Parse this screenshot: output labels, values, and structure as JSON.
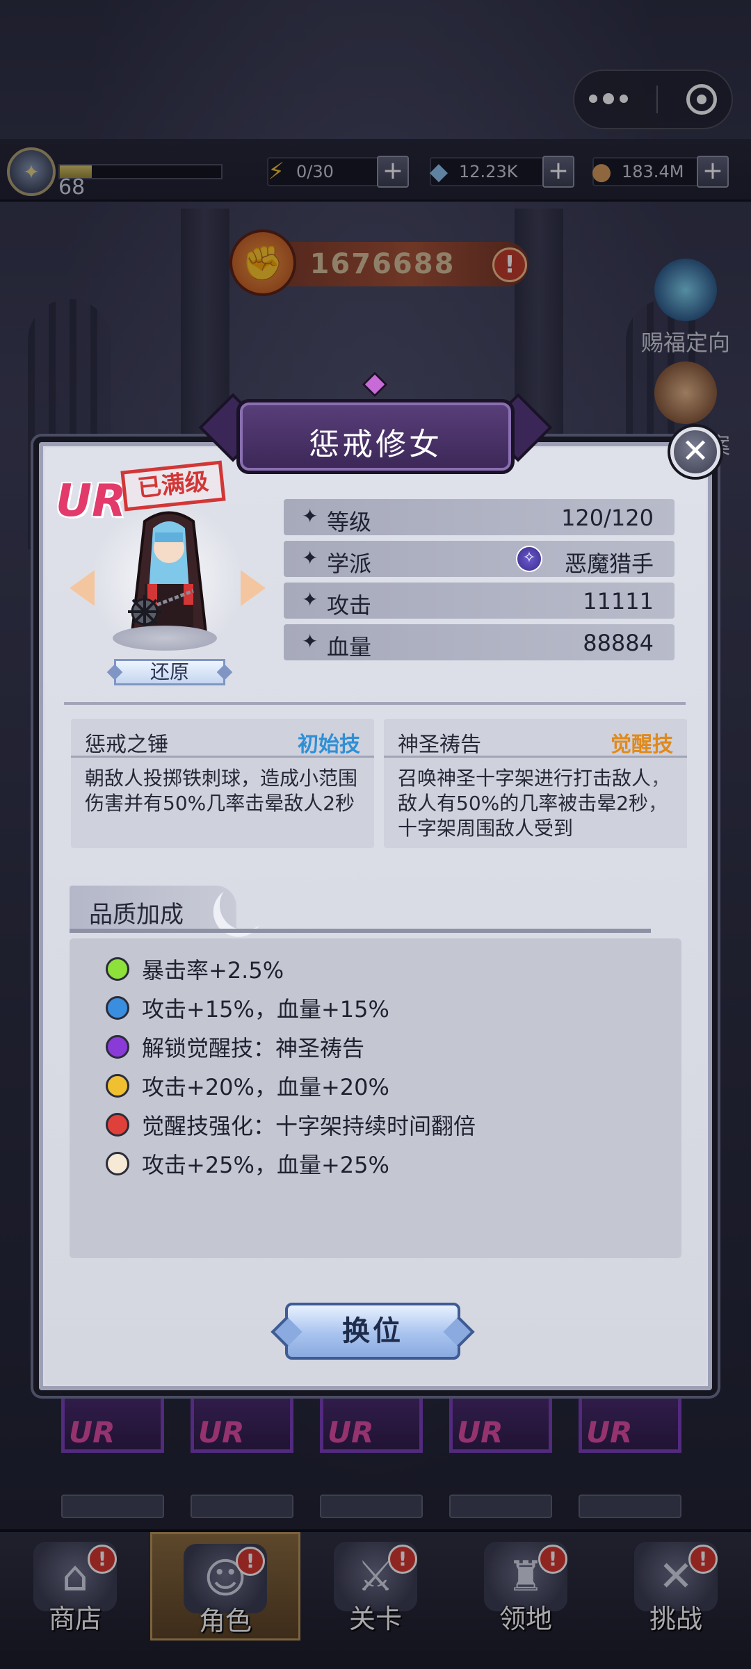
{
  "topbar": {
    "level": "68",
    "xp_fraction": 0.2,
    "resources": [
      {
        "name": "energy",
        "value": "0/30",
        "icon": "lightning-icon"
      },
      {
        "name": "gems",
        "value": "12.23K",
        "icon": "crystal-icon"
      },
      {
        "name": "gold",
        "value": "183.4M",
        "icon": "coin-icon"
      }
    ]
  },
  "combat_power": "1676688",
  "side_buttons": {
    "blessing": "赐福定向",
    "team": "编队方案"
  },
  "modal": {
    "title": "惩戒修女",
    "rarity": "UR",
    "maxed_label": "已满级",
    "restore_label": "还原",
    "stats": [
      {
        "label": "等级",
        "value": "120/120"
      },
      {
        "label": "学派",
        "value": "恶魔猎手"
      },
      {
        "label": "攻击",
        "value": "11111"
      },
      {
        "label": "血量",
        "value": "88884"
      }
    ],
    "skills": [
      {
        "name": "惩戒之锤",
        "tag": "初始技",
        "tag_color": "#2e8fd6",
        "desc": "朝敌人投掷铁刺球，造成小范围伤害并有50%几率击晕敌人2秒"
      },
      {
        "name": "神圣祷告",
        "tag": "觉醒技",
        "tag_color": "#e08a1c",
        "desc": "召唤神圣十字架进行打击敌人，敌人有50%的几率被击晕2秒，十字架周围敌人受到"
      }
    ],
    "quality": {
      "title": "品质加成",
      "items": [
        {
          "text": "暴击率+2.5%",
          "color": "#8ee03a"
        },
        {
          "text": "攻击+15%，血量+15%",
          "color": "#3a8ee0"
        },
        {
          "text": "解锁觉醒技：神圣祷告",
          "color": "#8a3ad6"
        },
        {
          "text": "攻击+20%，血量+20%",
          "color": "#f0c030"
        },
        {
          "text": "觉醒技强化：十字架持续时间翻倍",
          "color": "#e0403a"
        },
        {
          "text": "攻击+25%，血量+25%",
          "color": "#f6ead6"
        }
      ]
    },
    "swap_label": "换位"
  },
  "cards": [
    "UR",
    "UR",
    "UR",
    "UR",
    "UR"
  ],
  "nav": [
    {
      "label": "商店",
      "icon": "shop-icon",
      "badge": "!"
    },
    {
      "label": "角色",
      "icon": "character-icon",
      "badge": "!",
      "active": true
    },
    {
      "label": "关卡",
      "icon": "crossed-swords-icon",
      "badge": "!"
    },
    {
      "label": "领地",
      "icon": "castle-icon",
      "badge": "!"
    },
    {
      "label": "挑战",
      "icon": "challenge-map-icon",
      "badge": "!"
    }
  ]
}
